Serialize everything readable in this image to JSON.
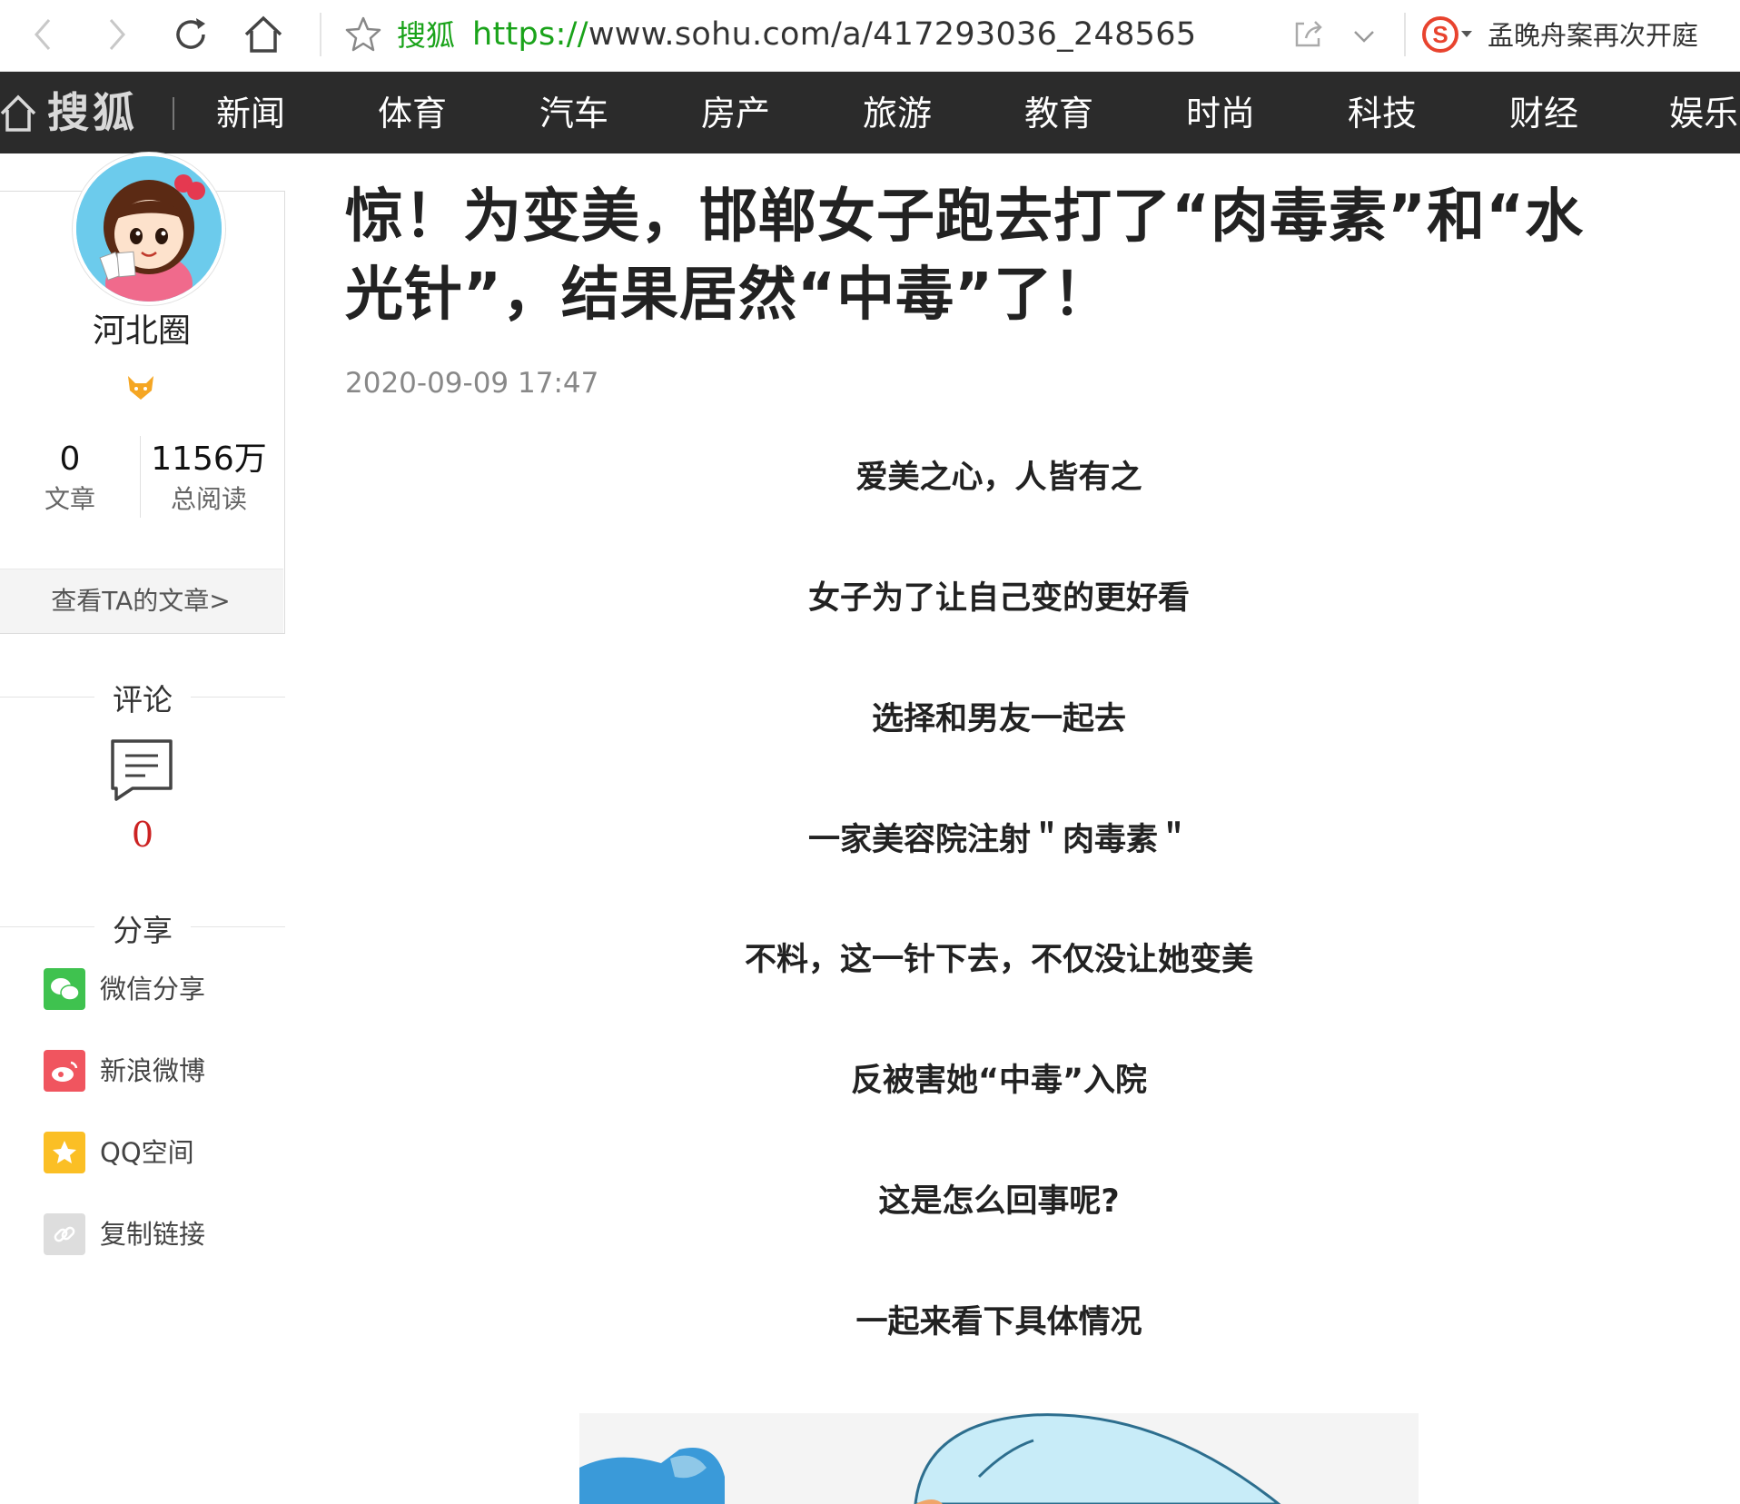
{
  "browser": {
    "site_name": "搜狐",
    "url_scheme": "https://",
    "url_rest": "www.sohu.com/a/417293036_248565",
    "search_hint": "孟晚舟案再次开庭",
    "icons": [
      "back-icon",
      "forward-icon",
      "reload-icon",
      "home-icon",
      "star-icon",
      "share-icon",
      "chevron-down-icon",
      "sogou-icon"
    ]
  },
  "nav": {
    "logo": "搜狐",
    "items": [
      "新闻",
      "体育",
      "汽车",
      "房产",
      "旅游",
      "教育",
      "时尚",
      "科技",
      "财经",
      "娱乐"
    ]
  },
  "author": {
    "name": "河北圈",
    "articles_count": "0",
    "articles_label": "文章",
    "reads_count": "1156万",
    "reads_label": "总阅读",
    "view_articles_link": "查看TA的文章>"
  },
  "comments": {
    "title": "评论",
    "count": "0"
  },
  "share": {
    "title": "分享",
    "items": [
      {
        "label": "微信分享",
        "icon": "wechat-icon",
        "color": "#3fc24f"
      },
      {
        "label": "新浪微博",
        "icon": "weibo-icon",
        "color": "#f0555f"
      },
      {
        "label": "QQ空间",
        "icon": "qzone-icon",
        "color": "#fbbf25"
      },
      {
        "label": "复制链接",
        "icon": "link-icon",
        "color": "#dddddd"
      }
    ]
  },
  "article": {
    "title": "惊！为变美，邯郸女子跑去打了“肉毒素”和“水光针”，结果居然“中毒”了！",
    "date": "2020-09-09 17:47",
    "paragraphs": [
      "爱美之心，人皆有之",
      "女子为了让自己变的更好看",
      "选择和男友一起去",
      "一家美容院注射＂肉毒素＂",
      "不料，这一针下去，不仅没让她变美",
      "反被害她“中毒”入院",
      "这是怎么回事呢?",
      "一起来看下具体情况"
    ]
  },
  "colors": {
    "nav_bg": "#2b2b2b",
    "url_green": "#1aa31a",
    "comment_red": "#cc2222"
  }
}
